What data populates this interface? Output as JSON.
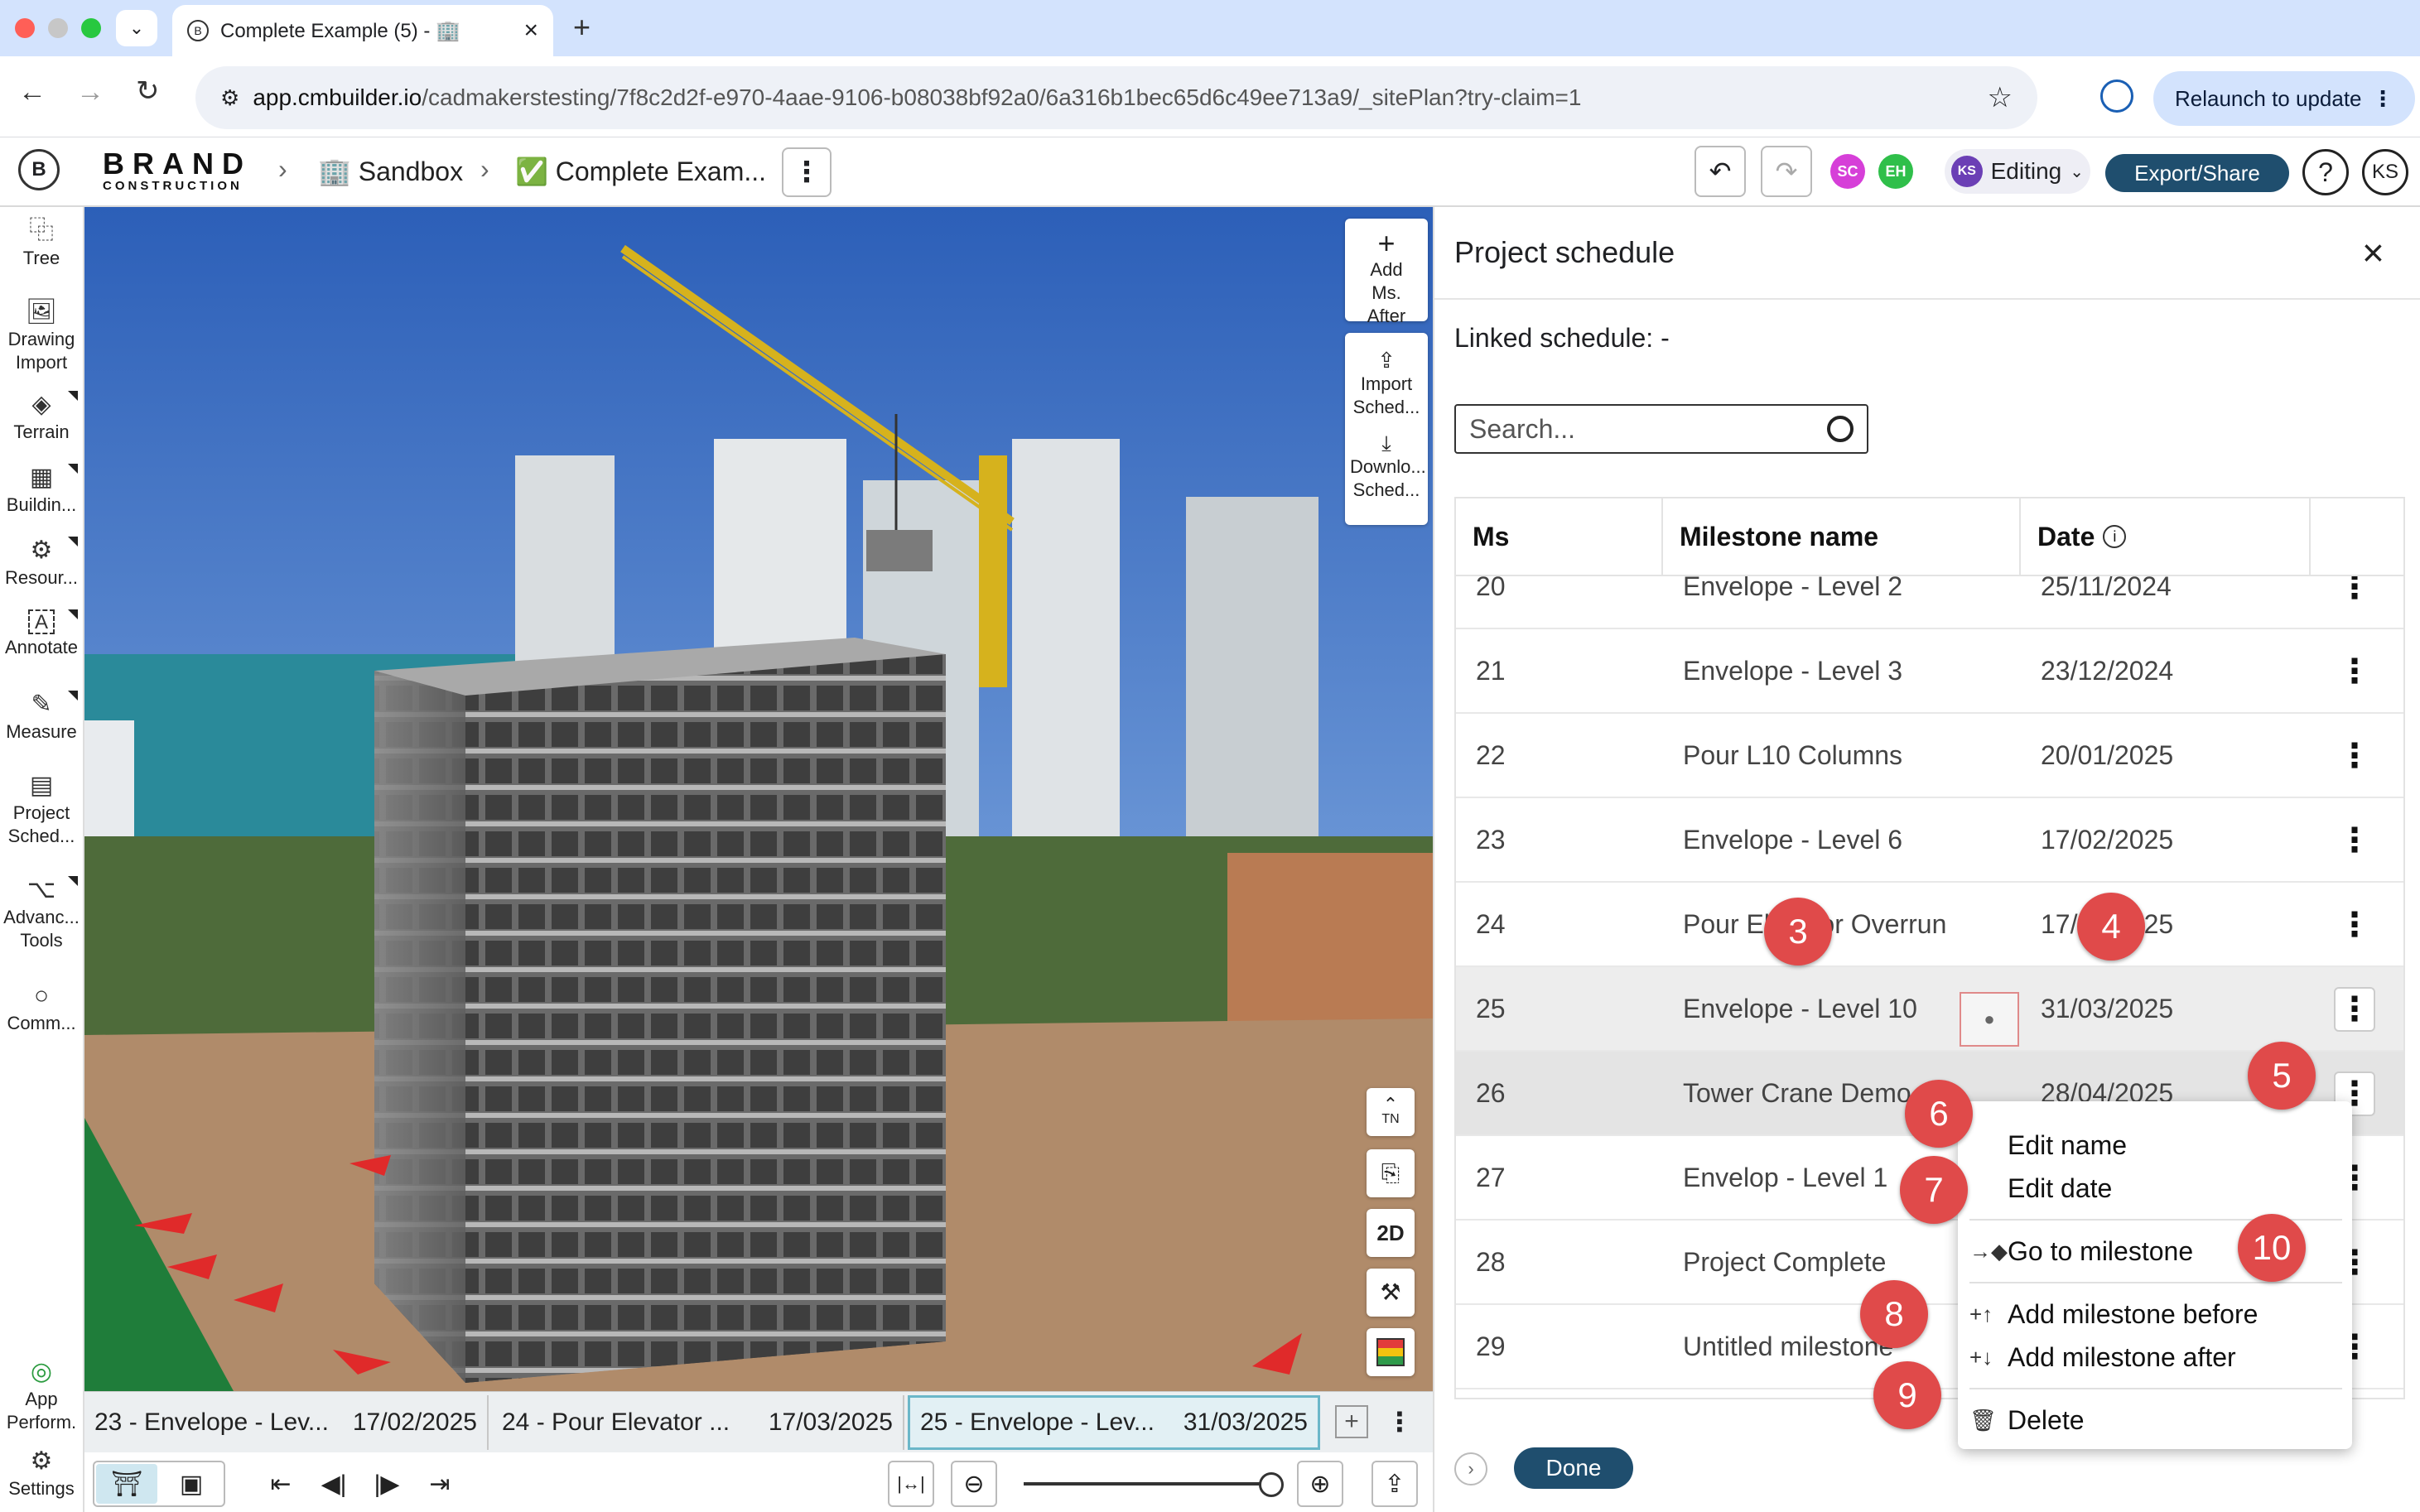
{
  "browser": {
    "tab_title": "Complete Example (5) - 🏢",
    "url_host": "app.cmbuilder.io",
    "url_path": "/cadmakerstesting/7f8c2d2f-e970-4aae-9106-b08038bf92a0/6a316b1bec65d6c49ee713a9/_sitePlan?try-claim=1",
    "relaunch_label": "Relaunch to update"
  },
  "header": {
    "brand_name": "BRAND",
    "brand_sub": "CONSTRUCTION",
    "breadcrumb_1": "🏢 Sandbox",
    "breadcrumb_2": "✅ Complete Exam...",
    "collab_1": "SC",
    "collab_2": "EH",
    "user_initials": "KS",
    "mode": "Editing",
    "export_label": "Export/Share",
    "help": "?",
    "profile_initials": "KS"
  },
  "left_rail": [
    {
      "icon": "⿻",
      "label": "Tree"
    },
    {
      "icon": "🖼",
      "label": "Drawing Import"
    },
    {
      "icon": "◈",
      "label": "Terrain"
    },
    {
      "icon": "▦",
      "label": "Buildin..."
    },
    {
      "icon": "⚙",
      "label": "Resour..."
    },
    {
      "icon": "A",
      "label": "Annotate"
    },
    {
      "icon": "✎",
      "label": "Measure"
    },
    {
      "icon": "▤",
      "label": "Project Sched..."
    },
    {
      "icon": "⌥",
      "label": "Advanc... Tools"
    },
    {
      "icon": "○",
      "label": "Comm..."
    },
    {
      "icon": "◎",
      "label": "App Perform."
    },
    {
      "icon": "⚙",
      "label": "Settings"
    }
  ],
  "viewport_tools": {
    "add_ms_after": "Add Ms. After",
    "import_sched": "Import Sched...",
    "download_sched": "Downlo... Sched...",
    "north": "TN",
    "view_2d": "2D"
  },
  "timeline": [
    {
      "label": "23 - Envelope - Lev...",
      "date": "17/02/2025"
    },
    {
      "label": "24 - Pour Elevator ...",
      "date": "17/03/2025"
    },
    {
      "label": "25 - Envelope - Lev...",
      "date": "31/03/2025"
    }
  ],
  "panel": {
    "title": "Project schedule",
    "linked_schedule": "Linked schedule: -",
    "search_placeholder": "Search...",
    "col_ms": "Ms",
    "col_name": "Milestone name",
    "col_date": "Date",
    "done_label": "Done"
  },
  "rows": [
    {
      "ms": "20",
      "name": "Envelope - Level 2",
      "date": "25/11/2024"
    },
    {
      "ms": "21",
      "name": "Envelope - Level 3",
      "date": "23/12/2024"
    },
    {
      "ms": "22",
      "name": "Pour L10 Columns",
      "date": "20/01/2025"
    },
    {
      "ms": "23",
      "name": "Envelope - Level 6",
      "date": "17/02/2025"
    },
    {
      "ms": "24",
      "name": "Pour Elevator Overrun",
      "date": "17/03/2025"
    },
    {
      "ms": "25",
      "name": "Envelope - Level 10",
      "date": "31/03/2025"
    },
    {
      "ms": "26",
      "name": "Tower Crane Demo",
      "date": "28/04/2025"
    },
    {
      "ms": "27",
      "name": "Envelop - Level 1",
      "date": ""
    },
    {
      "ms": "28",
      "name": "Project Complete",
      "date": ""
    },
    {
      "ms": "29",
      "name": "Untitled milestone",
      "date": ""
    }
  ],
  "context_menu": {
    "edit_name": "Edit name",
    "edit_date": "Edit date",
    "go_to": "Go to milestone",
    "add_before": "Add milestone before",
    "add_after": "Add milestone after",
    "delete": "Delete"
  },
  "callouts": {
    "c3": "3",
    "c4": "4",
    "c5": "5",
    "c6": "6",
    "c7": "7",
    "c8": "8",
    "c9": "9",
    "c10": "10"
  },
  "colors": {
    "accent": "#1f4e6e",
    "callout": "#e04a4a",
    "selected_row": "#ededed"
  }
}
